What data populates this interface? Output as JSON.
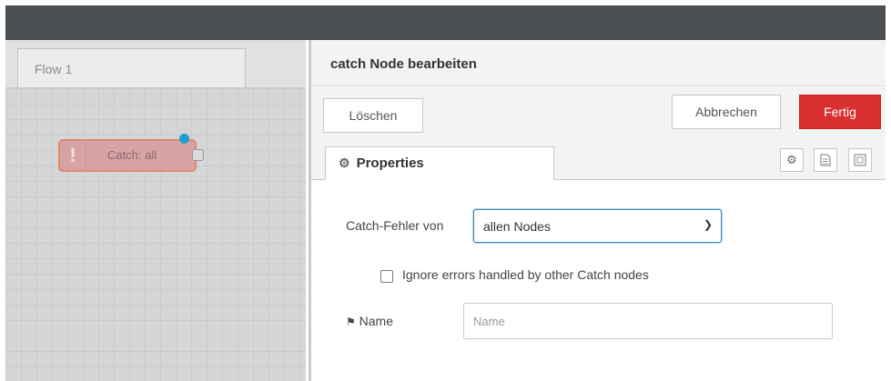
{
  "workspace": {
    "tab_label": "Flow 1",
    "node": {
      "icon": "exclamation-icon",
      "label": "Catch: all"
    }
  },
  "editor": {
    "title": "catch Node bearbeiten",
    "buttons": {
      "delete": "Löschen",
      "cancel": "Abbrechen",
      "done": "Fertig"
    },
    "properties_tab": {
      "icon": "gear-icon",
      "label": "Properties"
    },
    "tab_icons": [
      "gear-icon",
      "description-icon",
      "appearance-icon"
    ],
    "form": {
      "catch_from_label": "Catch-Fehler von",
      "catch_from_value": "allen Nodes",
      "ignore_checkbox_label": "Ignore errors handled by other Catch nodes",
      "ignore_checkbox_checked": false,
      "name_label": "Name",
      "name_placeholder": "Name",
      "name_value": ""
    }
  },
  "colors": {
    "topbar": "#4b4e52",
    "done_button": "#d92f2f",
    "node_fill": "#d7a3a6",
    "status_dot": "#1e9fd0"
  }
}
